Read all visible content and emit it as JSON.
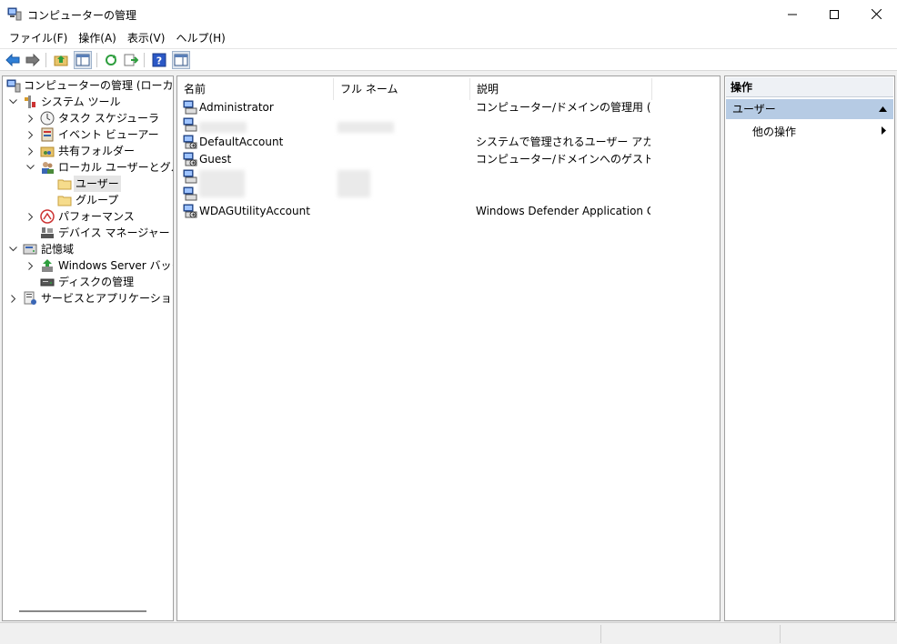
{
  "window": {
    "title": "コンピューターの管理",
    "minimize_glyph": "—",
    "maximize_glyph": "☐",
    "close_glyph": "✕"
  },
  "menu": [
    "ファイル(F)",
    "操作(A)",
    "表示(V)",
    "ヘルプ(H)"
  ],
  "tree": {
    "root": "コンピューターの管理 (ローカル)",
    "system_tools": "システム ツール",
    "task_scheduler": "タスク スケジューラ",
    "event_viewer": "イベント ビューアー",
    "shared_folders": "共有フォルダー",
    "local_users_groups": "ローカル ユーザーとグループ",
    "users": "ユーザー",
    "groups": "グループ",
    "performance": "パフォーマンス",
    "device_manager": "デバイス マネージャー",
    "storage": "記憶域",
    "windows_server_backup": "Windows Server バックア",
    "disk_management": "ディスクの管理",
    "services_apps": "サービスとアプリケーション"
  },
  "list": {
    "columns": [
      "名前",
      "フル ネーム",
      "説明"
    ],
    "rows": [
      {
        "name": "Administrator",
        "fullname": "",
        "description": "コンピューター/ドメインの管理用 (ビルト..."
      },
      {
        "name": "",
        "fullname": "",
        "description": ""
      },
      {
        "name": "DefaultAccount",
        "fullname": "",
        "description": "システムで管理されるユーザー アカウン..."
      },
      {
        "name": "Guest",
        "fullname": "",
        "description": "コンピューター/ドメインへのゲスト アクセ..."
      },
      {
        "name": "",
        "fullname": "",
        "description": ""
      },
      {
        "name": "",
        "fullname": "",
        "description": ""
      },
      {
        "name": "WDAGUtilityAccount",
        "fullname": "",
        "description": "Windows Defender Application G..."
      }
    ]
  },
  "actions": {
    "header": "操作",
    "section": "ユーザー",
    "more": "他の操作"
  }
}
